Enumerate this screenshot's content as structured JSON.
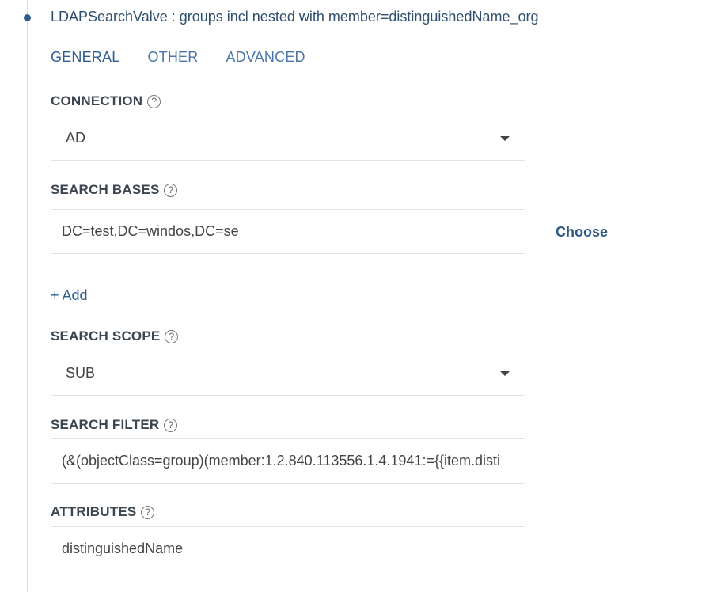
{
  "valve": {
    "title": "LDAPSearchValve : groups incl nested with member=distinguishedName_org"
  },
  "tabs": [
    {
      "label": "GENERAL",
      "active": true
    },
    {
      "label": "OTHER",
      "active": false
    },
    {
      "label": "ADVANCED",
      "active": false
    }
  ],
  "help_glyph": "?",
  "connection": {
    "label": "CONNECTION",
    "value": "AD"
  },
  "search_bases": {
    "label": "SEARCH BASES",
    "value": "DC=test,DC=windos,DC=se",
    "choose_label": "Choose",
    "add_label": "+ Add"
  },
  "search_scope": {
    "label": "SEARCH SCOPE",
    "value": "SUB"
  },
  "search_filter": {
    "label": "SEARCH FILTER",
    "value": "(&(objectClass=group)(member:1.2.840.113556.1.4.1941:={{item.disti"
  },
  "attributes": {
    "label": "ATTRIBUTES",
    "value": "distinguishedName"
  },
  "colors": {
    "accent": "#2e5f93",
    "dot": "#2e5b8c",
    "border": "#e2e5e8"
  },
  "icons": {
    "help": "help-circle-icon",
    "dropdown": "chevron-down-icon"
  }
}
